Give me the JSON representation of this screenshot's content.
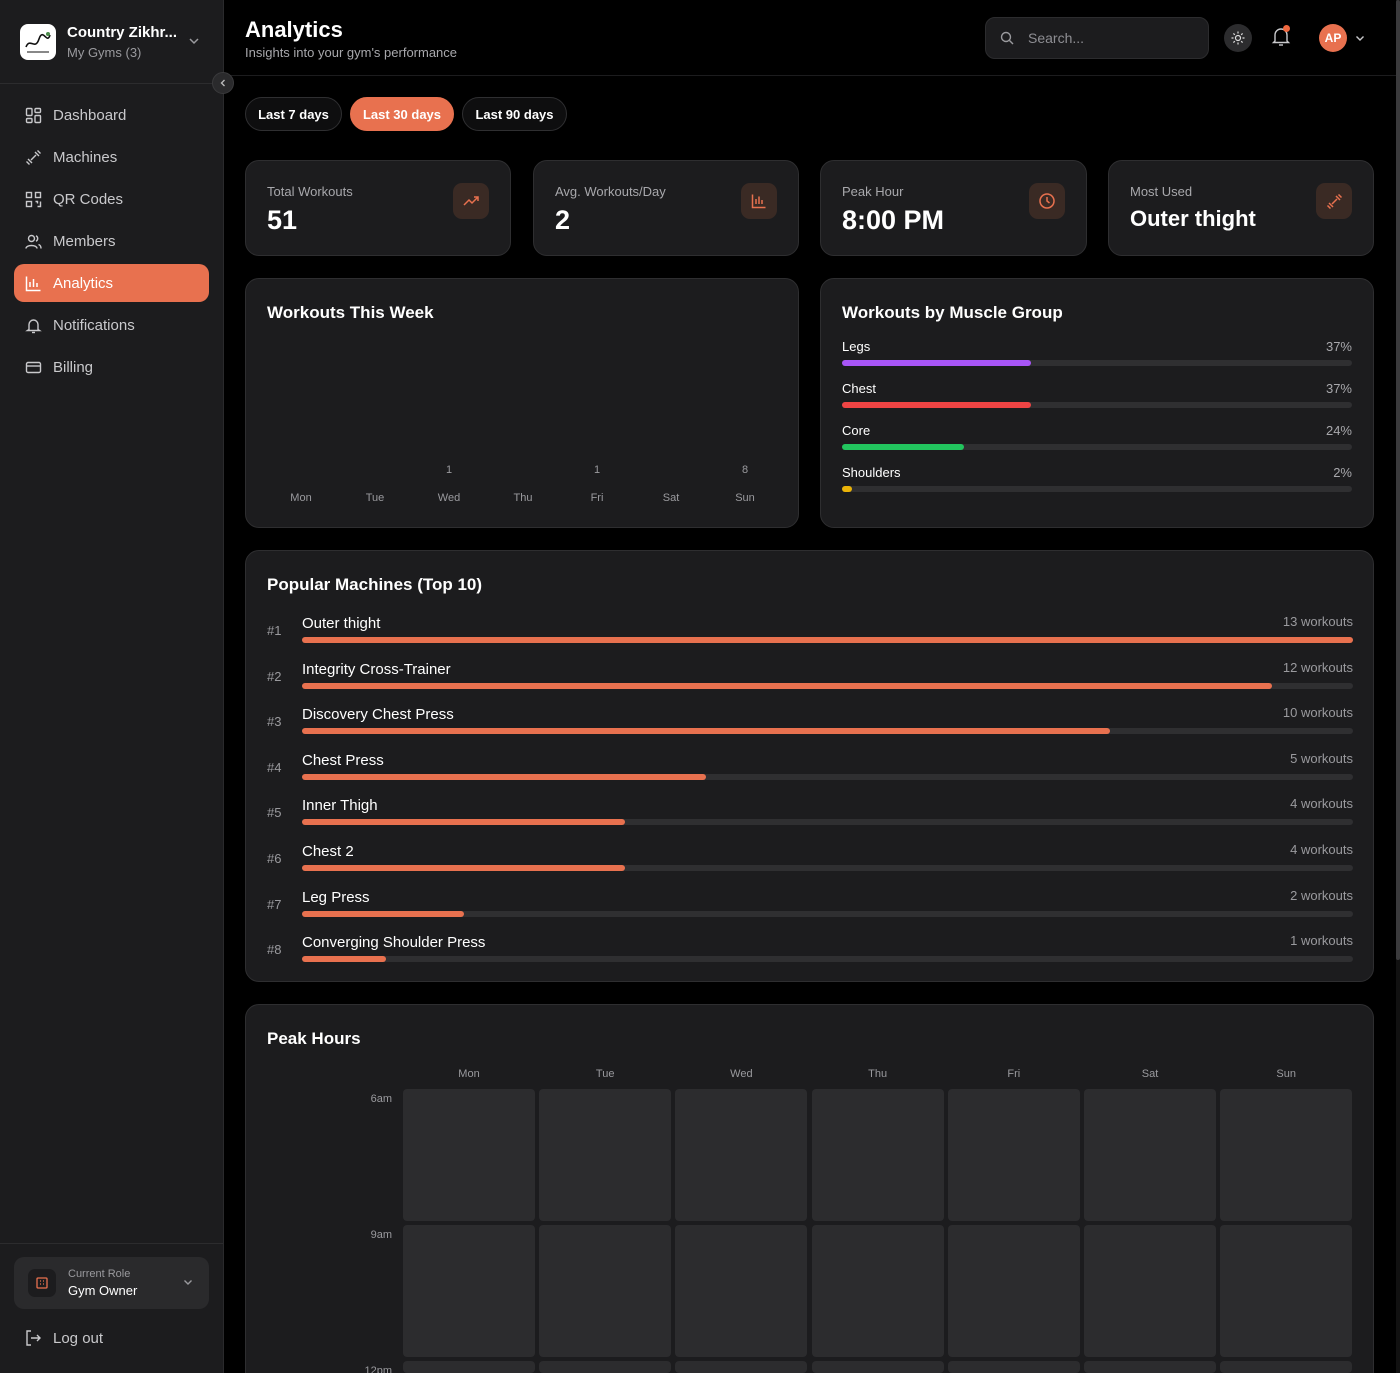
{
  "gym": {
    "name": "Country Zikhr...",
    "subtitle": "My Gyms (3)"
  },
  "nav": [
    {
      "label": "Dashboard",
      "icon": "dashboard-icon",
      "active": false
    },
    {
      "label": "Machines",
      "icon": "dumbbell-icon",
      "active": false
    },
    {
      "label": "QR Codes",
      "icon": "qr-code-icon",
      "active": false
    },
    {
      "label": "Members",
      "icon": "members-icon",
      "active": false
    },
    {
      "label": "Analytics",
      "icon": "bar-chart-icon",
      "active": true
    },
    {
      "label": "Notifications",
      "icon": "bell-icon",
      "active": false
    },
    {
      "label": "Billing",
      "icon": "credit-card-icon",
      "active": false
    }
  ],
  "role": {
    "label": "Current Role",
    "value": "Gym Owner"
  },
  "logout_label": "Log out",
  "header": {
    "title": "Analytics",
    "subtitle": "Insights into your gym's performance",
    "search_placeholder": "Search...",
    "avatar_initials": "AP"
  },
  "filters": [
    {
      "label": "Last 7 days",
      "active": false
    },
    {
      "label": "Last 30 days",
      "active": true
    },
    {
      "label": "Last 90 days",
      "active": false
    }
  ],
  "stats": [
    {
      "label": "Total Workouts",
      "value": "51",
      "icon": "trending-up-icon"
    },
    {
      "label": "Avg. Workouts/Day",
      "value": "2",
      "icon": "bar-chart-icon"
    },
    {
      "label": "Peak Hour",
      "value": "8:00 PM",
      "icon": "clock-icon"
    },
    {
      "label": "Most Used",
      "value": "Outer thight",
      "icon": "dumbbell-icon"
    }
  ],
  "week_card": {
    "title": "Workouts This Week"
  },
  "chart_data": {
    "type": "bar",
    "title": "Workouts This Week",
    "categories": [
      "Mon",
      "Tue",
      "Wed",
      "Thu",
      "Fri",
      "Sat",
      "Sun"
    ],
    "values": [
      0,
      0,
      1,
      0,
      1,
      0,
      8
    ],
    "labels": [
      "",
      "",
      "1",
      "",
      "1",
      "",
      "8"
    ]
  },
  "muscle_card": {
    "title": "Workouts by Muscle Group"
  },
  "muscle_groups": [
    {
      "label": "Legs",
      "pct": "37%",
      "value": 37,
      "color": "#a855f7"
    },
    {
      "label": "Chest",
      "pct": "37%",
      "value": 37,
      "color": "#ef4444"
    },
    {
      "label": "Core",
      "pct": "24%",
      "value": 24,
      "color": "#22c55e"
    },
    {
      "label": "Shoulders",
      "pct": "2%",
      "value": 2,
      "color": "#eab308"
    }
  ],
  "machines_card": {
    "title": "Popular Machines (Top 10)"
  },
  "machines": [
    {
      "rank": "#1",
      "name": "Outer thight",
      "count": "13 workouts",
      "value": 13
    },
    {
      "rank": "#2",
      "name": "Integrity Cross-Trainer",
      "count": "12 workouts",
      "value": 12
    },
    {
      "rank": "#3",
      "name": "Discovery Chest Press",
      "count": "10 workouts",
      "value": 10
    },
    {
      "rank": "#4",
      "name": "Chest Press",
      "count": "5 workouts",
      "value": 5
    },
    {
      "rank": "#5",
      "name": "Inner Thigh",
      "count": "4 workouts",
      "value": 4
    },
    {
      "rank": "#6",
      "name": "Chest 2",
      "count": "4 workouts",
      "value": 4
    },
    {
      "rank": "#7",
      "name": "Leg Press",
      "count": "2 workouts",
      "value": 2
    },
    {
      "rank": "#8",
      "name": "Converging Shoulder Press",
      "count": "1 workouts",
      "value": 1
    }
  ],
  "peak_card": {
    "title": "Peak Hours"
  },
  "peak_days": [
    "Mon",
    "Tue",
    "Wed",
    "Thu",
    "Fri",
    "Sat",
    "Sun"
  ],
  "peak_hours": [
    "6am",
    "9am",
    "12pm"
  ]
}
